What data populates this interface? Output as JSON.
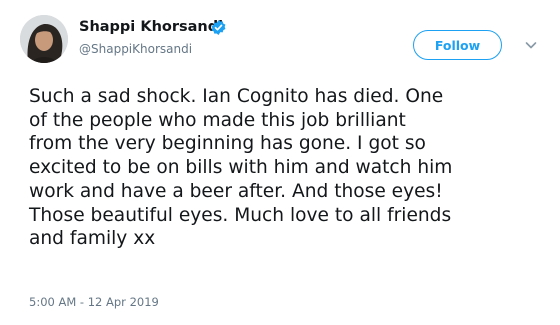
{
  "author": {
    "display_name": "Shappi Khorsandi",
    "handle": "@ShappiKhorsandi",
    "verified_icon": "verified-badge-icon",
    "avatar": "profile-photo"
  },
  "actions": {
    "follow_label": "Follow",
    "more_icon": "chevron-down-icon"
  },
  "tweet": {
    "lines": [
      "Such a sad shock. Ian Cognito has died. One",
      "of the people who made this job brilliant",
      "from the very beginning has gone. I got so",
      "excited to be on bills with him and watch him",
      "work and have a beer after. And those eyes!",
      "Those beautiful eyes. Much love to all friends",
      "and family xx"
    ],
    "timestamp": "5:00 AM - 12 Apr 2019"
  },
  "colors": {
    "accent": "#1da1f2",
    "text": "#14171a",
    "secondary_text": "#657786"
  }
}
